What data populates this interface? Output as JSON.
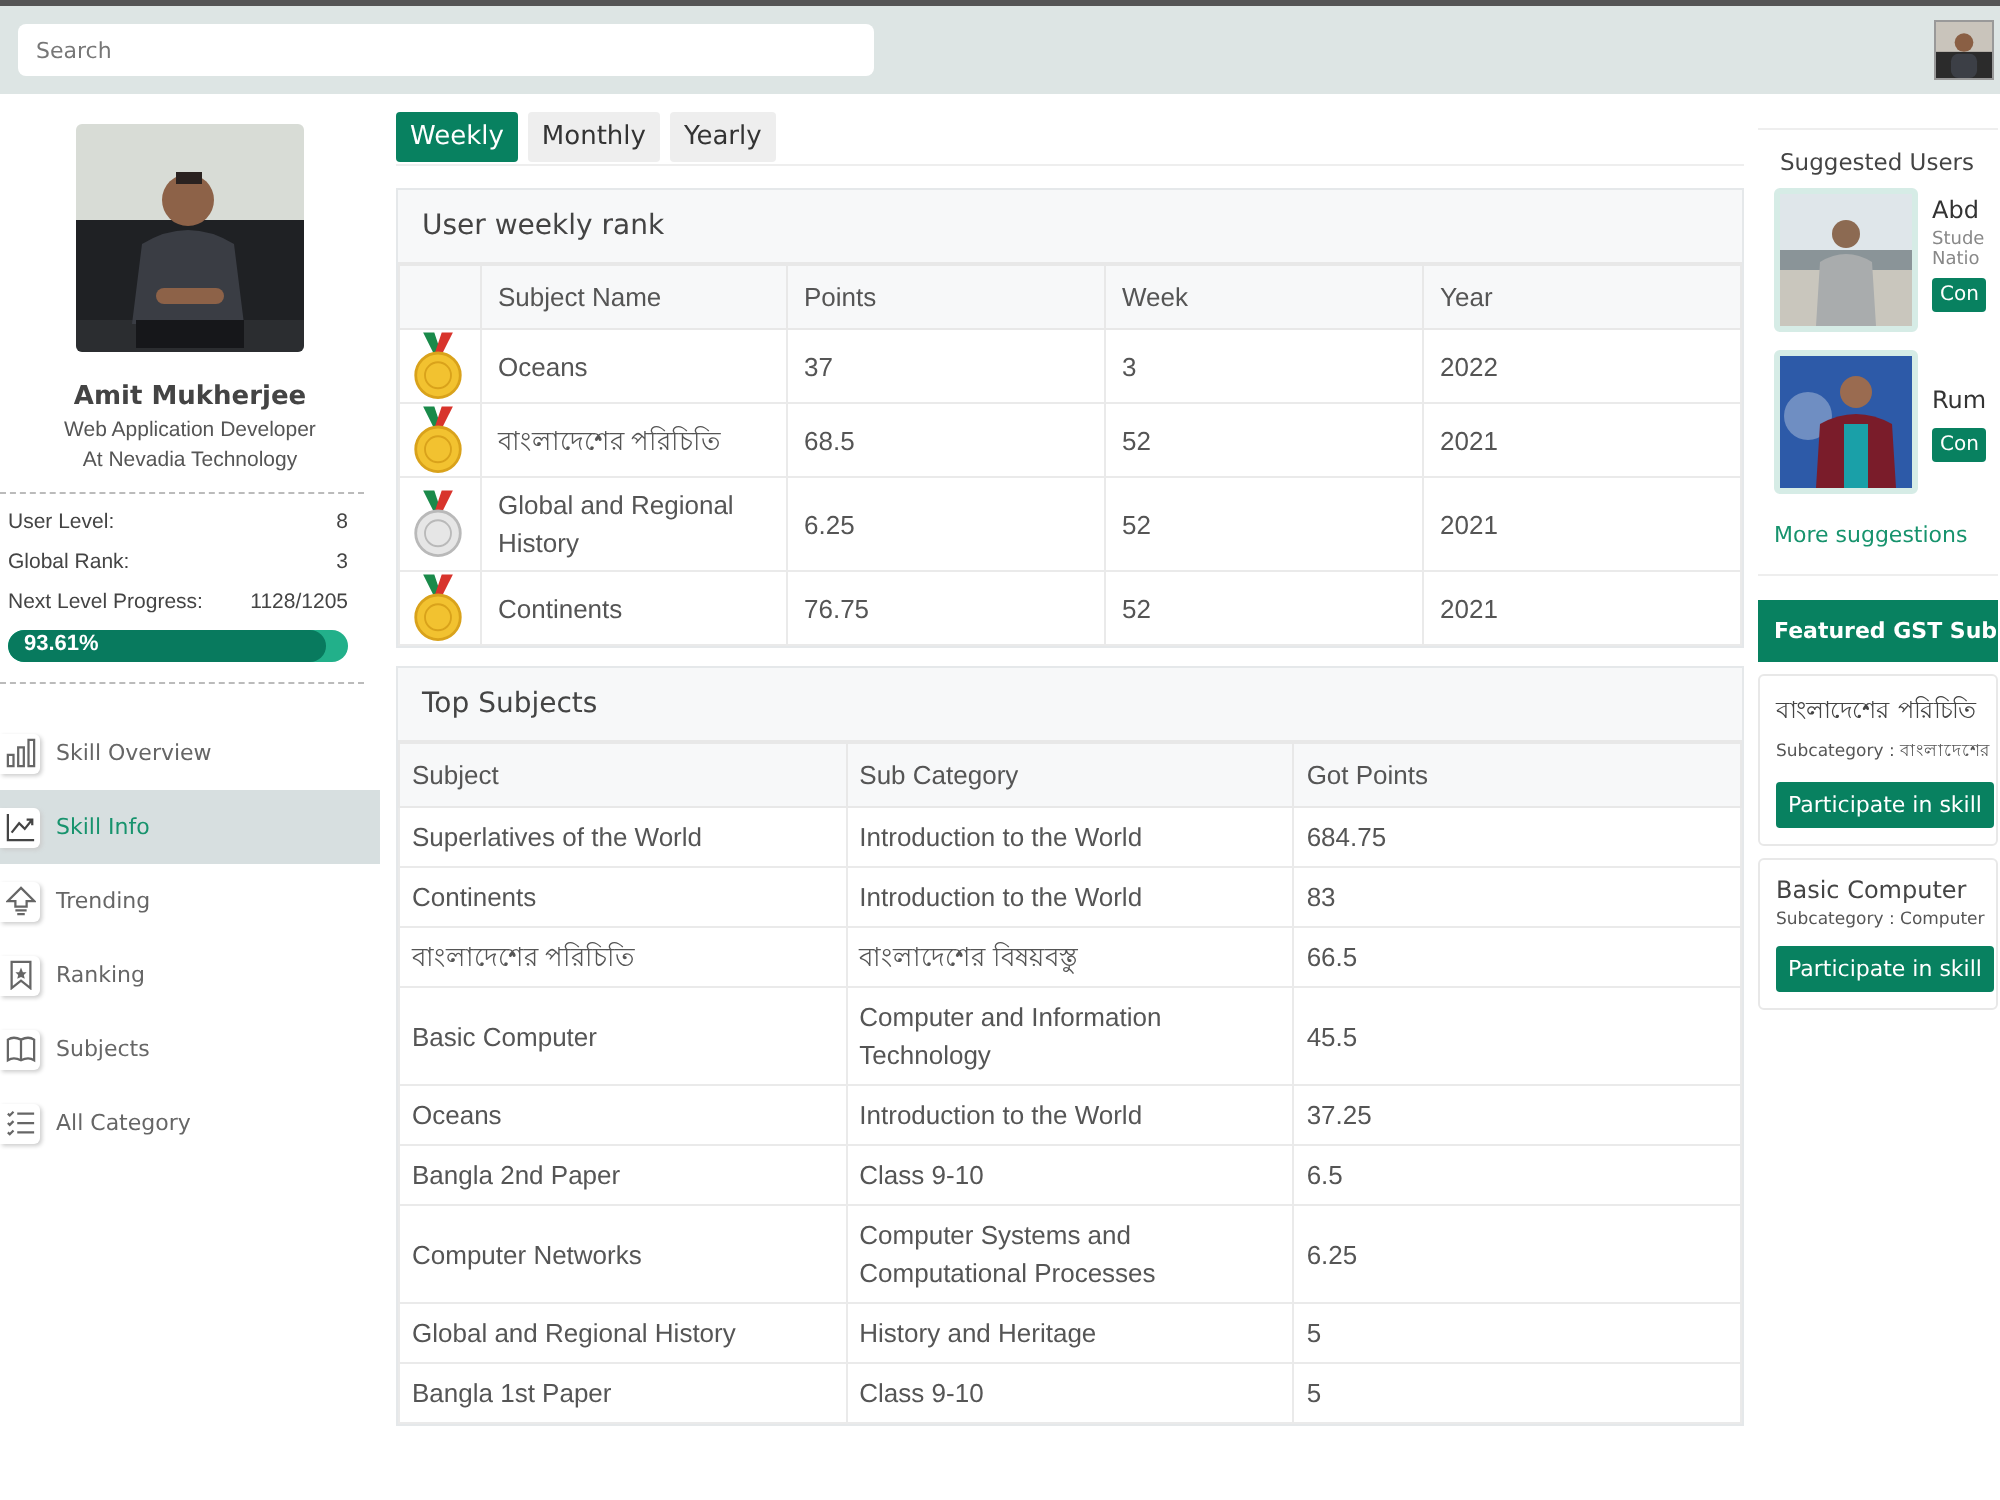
{
  "search": {
    "placeholder": "Search"
  },
  "profile": {
    "name": "Amit Mukherjee",
    "title": "Web Application Developer",
    "company": "At Nevadia Technology",
    "stats": [
      {
        "label": "User Level:",
        "value": "8"
      },
      {
        "label": "Global Rank:",
        "value": "3"
      },
      {
        "label": "Next Level Progress:",
        "value": "1128/1205"
      }
    ],
    "progress": {
      "level": 0.9361,
      "reading": "93.61%"
    }
  },
  "nav": [
    {
      "label": "Skill Overview",
      "selected": false
    },
    {
      "label": "Skill Info",
      "selected": true
    },
    {
      "label": "Trending",
      "selected": false
    },
    {
      "label": "Ranking",
      "selected": false
    },
    {
      "label": "Subjects",
      "selected": false
    },
    {
      "label": "All Category",
      "selected": false
    }
  ],
  "tabs": [
    {
      "label": "Weekly",
      "selected": true
    },
    {
      "label": "Monthly",
      "selected": false
    },
    {
      "label": "Yearly",
      "selected": false
    }
  ],
  "weekly_rank": {
    "title": "User weekly rank",
    "columns": [
      "Subject Name",
      "Points",
      "Week",
      "Year"
    ],
    "rows": [
      {
        "kind": "gold",
        "cells": [
          "Oceans",
          "37",
          "3",
          "2022"
        ]
      },
      {
        "kind": "gold",
        "cells": [
          "বাংলাদেশের পরিচিতি",
          "68.5",
          "52",
          "2021"
        ]
      },
      {
        "kind": "silver",
        "cells": [
          "Global and Regional History",
          "6.25",
          "52",
          "2021"
        ]
      },
      {
        "kind": "gold",
        "cells": [
          "Continents",
          "76.75",
          "52",
          "2021"
        ]
      }
    ]
  },
  "top_subjects": {
    "title": "Top Subjects",
    "columns": [
      "Subject",
      "Sub Category",
      "Got Points"
    ],
    "rows": [
      [
        "Superlatives of the World",
        "Introduction to the World",
        "684.75"
      ],
      [
        "Continents",
        "Introduction to the World",
        "83"
      ],
      [
        "বাংলাদেশের পরিচিতি",
        "বাংলাদেশের বিষয়বস্তু",
        "66.5"
      ],
      [
        "Basic Computer",
        "Computer and Information Technology",
        "45.5"
      ],
      [
        "Oceans",
        "Introduction to the World",
        "37.25"
      ],
      [
        "Bangla 2nd Paper",
        "Class 9-10",
        "6.5"
      ],
      [
        "Computer Networks",
        "Computer Systems and Computational Processes",
        "6.25"
      ],
      [
        "Global and Regional History",
        "History and Heritage",
        "5"
      ],
      [
        "Bangla 1st Paper",
        "Class 9-10",
        "5"
      ]
    ]
  },
  "suggested_users": {
    "title": "Suggested Users",
    "users": [
      {
        "name": "Abd",
        "lines": [
          "Stude",
          "Natio"
        ],
        "button": "Con"
      },
      {
        "name": "Rum",
        "button": "Con"
      }
    ],
    "more": "More suggestions"
  },
  "featured": {
    "title": "Featured GST Sub",
    "items": [
      {
        "title": "বাংলাদেশের পরিচিতি",
        "subcategory": "Subcategory : বাংলাদেশের",
        "button": "Participate in skill"
      },
      {
        "title": "Basic Computer",
        "subcategory": "Subcategory : Computer",
        "button": "Participate in skill"
      }
    ]
  }
}
